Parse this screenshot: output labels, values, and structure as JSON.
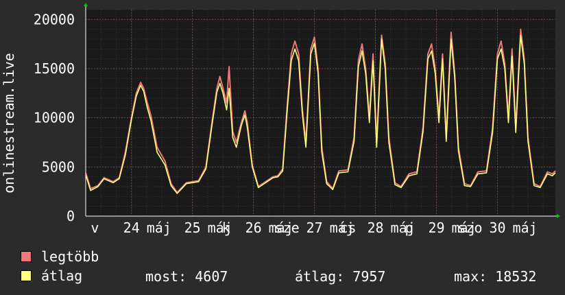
{
  "colors": {
    "background": "#2b2b2b",
    "plot": "#1a1a1a",
    "grid_major": "#6a4848",
    "grid_minor": "#3a3434",
    "axis": "#ffffff",
    "text": "#ffffff",
    "series_max": "#f07878",
    "series_avg": "#ffff80",
    "arrow": "#00cc00"
  },
  "chart_data": {
    "type": "line",
    "ylabel": "onlinestream.live",
    "ylim": [
      0,
      21000
    ],
    "yticks": [
      0,
      5000,
      10000,
      15000,
      20000
    ],
    "xlim": [
      23.25,
      30.95
    ],
    "x_tick_labels": [
      {
        "x": 23.4,
        "label": "v"
      },
      {
        "x": 24.0,
        "label": "24"
      },
      {
        "x": 24.45,
        "label": "máj"
      },
      {
        "x": 25.0,
        "label": "25"
      },
      {
        "x": 25.45,
        "label": "máj"
      },
      {
        "x": 25.55,
        "label": "k"
      },
      {
        "x": 26.0,
        "label": "26"
      },
      {
        "x": 26.45,
        "label": "máj"
      },
      {
        "x": 26.55,
        "label": "sze"
      },
      {
        "x": 27.0,
        "label": "27"
      },
      {
        "x": 27.45,
        "label": "máj"
      },
      {
        "x": 27.55,
        "label": "cs"
      },
      {
        "x": 28.0,
        "label": "28"
      },
      {
        "x": 28.45,
        "label": "máj"
      },
      {
        "x": 28.55,
        "label": "p"
      },
      {
        "x": 29.0,
        "label": "29"
      },
      {
        "x": 29.45,
        "label": "máj"
      },
      {
        "x": 29.55,
        "label": "szo"
      },
      {
        "x": 30.0,
        "label": "30"
      },
      {
        "x": 30.45,
        "label": "máj"
      }
    ],
    "series": [
      {
        "name": "legtöbb",
        "color": "#f07878",
        "values": [
          [
            23.25,
            4400
          ],
          [
            23.33,
            2800
          ],
          [
            23.45,
            3100
          ],
          [
            23.55,
            3900
          ],
          [
            23.7,
            3500
          ],
          [
            23.8,
            3900
          ],
          [
            23.9,
            6500
          ],
          [
            24.0,
            10000
          ],
          [
            24.08,
            12500
          ],
          [
            24.15,
            13600
          ],
          [
            24.2,
            13000
          ],
          [
            24.26,
            11500
          ],
          [
            24.32,
            10200
          ],
          [
            24.42,
            7000
          ],
          [
            24.55,
            5600
          ],
          [
            24.65,
            3300
          ],
          [
            24.75,
            2400
          ],
          [
            24.9,
            3400
          ],
          [
            25.1,
            3600
          ],
          [
            25.22,
            5000
          ],
          [
            25.32,
            9500
          ],
          [
            25.4,
            13000
          ],
          [
            25.45,
            14200
          ],
          [
            25.5,
            13000
          ],
          [
            25.56,
            11500
          ],
          [
            25.6,
            15200
          ],
          [
            25.66,
            8600
          ],
          [
            25.72,
            7500
          ],
          [
            25.8,
            9500
          ],
          [
            25.86,
            10700
          ],
          [
            25.9,
            9500
          ],
          [
            25.98,
            5200
          ],
          [
            26.08,
            3000
          ],
          [
            26.2,
            3500
          ],
          [
            26.32,
            4000
          ],
          [
            26.4,
            4100
          ],
          [
            26.48,
            4800
          ],
          [
            26.55,
            11000
          ],
          [
            26.62,
            16500
          ],
          [
            26.68,
            17800
          ],
          [
            26.74,
            16500
          ],
          [
            26.8,
            11000
          ],
          [
            26.86,
            7500
          ],
          [
            26.94,
            17000
          ],
          [
            27.0,
            18200
          ],
          [
            27.06,
            15000
          ],
          [
            27.12,
            7000
          ],
          [
            27.2,
            3500
          ],
          [
            27.3,
            2800
          ],
          [
            27.4,
            4600
          ],
          [
            27.55,
            4700
          ],
          [
            27.65,
            8000
          ],
          [
            27.72,
            15800
          ],
          [
            27.78,
            17500
          ],
          [
            27.84,
            15000
          ],
          [
            27.9,
            10000
          ],
          [
            27.96,
            16500
          ],
          [
            28.02,
            7500
          ],
          [
            28.1,
            18400
          ],
          [
            28.16,
            15500
          ],
          [
            28.22,
            8000
          ],
          [
            28.32,
            3400
          ],
          [
            28.42,
            3000
          ],
          [
            28.55,
            4300
          ],
          [
            28.68,
            4500
          ],
          [
            28.78,
            9000
          ],
          [
            28.86,
            16500
          ],
          [
            28.92,
            17500
          ],
          [
            28.98,
            15000
          ],
          [
            29.04,
            10000
          ],
          [
            29.1,
            16500
          ],
          [
            29.16,
            8000
          ],
          [
            29.24,
            18700
          ],
          [
            29.3,
            14500
          ],
          [
            29.36,
            7000
          ],
          [
            29.46,
            3300
          ],
          [
            29.56,
            3100
          ],
          [
            29.68,
            4500
          ],
          [
            29.82,
            4600
          ],
          [
            29.92,
            9000
          ],
          [
            30.0,
            16500
          ],
          [
            30.06,
            17800
          ],
          [
            30.12,
            15500
          ],
          [
            30.18,
            10000
          ],
          [
            30.24,
            17000
          ],
          [
            30.3,
            9000
          ],
          [
            30.38,
            19000
          ],
          [
            30.44,
            16000
          ],
          [
            30.5,
            8000
          ],
          [
            30.6,
            3300
          ],
          [
            30.7,
            3000
          ],
          [
            30.82,
            4500
          ],
          [
            30.9,
            4300
          ],
          [
            30.95,
            4600
          ]
        ]
      },
      {
        "name": "átlag",
        "color": "#ffff80",
        "values": [
          [
            23.25,
            4200
          ],
          [
            23.33,
            2600
          ],
          [
            23.45,
            3000
          ],
          [
            23.55,
            3800
          ],
          [
            23.7,
            3400
          ],
          [
            23.8,
            3800
          ],
          [
            23.9,
            6200
          ],
          [
            24.0,
            9800
          ],
          [
            24.08,
            12200
          ],
          [
            24.15,
            13300
          ],
          [
            24.2,
            12700
          ],
          [
            24.26,
            11000
          ],
          [
            24.32,
            9700
          ],
          [
            24.42,
            6500
          ],
          [
            24.55,
            5200
          ],
          [
            24.65,
            3100
          ],
          [
            24.75,
            2300
          ],
          [
            24.9,
            3300
          ],
          [
            25.1,
            3500
          ],
          [
            25.22,
            4800
          ],
          [
            25.32,
            9200
          ],
          [
            25.4,
            12600
          ],
          [
            25.45,
            13500
          ],
          [
            25.5,
            12500
          ],
          [
            25.56,
            10800
          ],
          [
            25.6,
            13000
          ],
          [
            25.66,
            8000
          ],
          [
            25.72,
            7000
          ],
          [
            25.8,
            9200
          ],
          [
            25.86,
            10300
          ],
          [
            25.9,
            9000
          ],
          [
            25.98,
            5000
          ],
          [
            26.08,
            2900
          ],
          [
            26.2,
            3400
          ],
          [
            26.32,
            3900
          ],
          [
            26.4,
            4000
          ],
          [
            26.48,
            4600
          ],
          [
            26.55,
            10500
          ],
          [
            26.62,
            15800
          ],
          [
            26.68,
            17000
          ],
          [
            26.74,
            15800
          ],
          [
            26.8,
            10500
          ],
          [
            26.86,
            7000
          ],
          [
            26.94,
            16500
          ],
          [
            27.0,
            17600
          ],
          [
            27.06,
            14500
          ],
          [
            27.12,
            6500
          ],
          [
            27.2,
            3300
          ],
          [
            27.3,
            2700
          ],
          [
            27.4,
            4400
          ],
          [
            27.55,
            4500
          ],
          [
            27.65,
            7600
          ],
          [
            27.72,
            15200
          ],
          [
            27.78,
            16800
          ],
          [
            27.84,
            14500
          ],
          [
            27.9,
            9500
          ],
          [
            27.96,
            15800
          ],
          [
            28.02,
            7000
          ],
          [
            28.1,
            18000
          ],
          [
            28.16,
            15000
          ],
          [
            28.22,
            7500
          ],
          [
            28.32,
            3200
          ],
          [
            28.42,
            2900
          ],
          [
            28.55,
            4100
          ],
          [
            28.68,
            4300
          ],
          [
            28.78,
            8600
          ],
          [
            28.86,
            16000
          ],
          [
            28.92,
            16800
          ],
          [
            28.98,
            14500
          ],
          [
            29.04,
            9500
          ],
          [
            29.1,
            16000
          ],
          [
            29.16,
            7600
          ],
          [
            29.24,
            18000
          ],
          [
            29.3,
            14000
          ],
          [
            29.36,
            6600
          ],
          [
            29.46,
            3100
          ],
          [
            29.56,
            3000
          ],
          [
            29.68,
            4300
          ],
          [
            29.82,
            4400
          ],
          [
            29.92,
            8500
          ],
          [
            30.0,
            16000
          ],
          [
            30.06,
            17000
          ],
          [
            30.12,
            15000
          ],
          [
            30.18,
            9500
          ],
          [
            30.24,
            16300
          ],
          [
            30.3,
            8500
          ],
          [
            30.38,
            18400
          ],
          [
            30.44,
            15500
          ],
          [
            30.5,
            7600
          ],
          [
            30.6,
            3100
          ],
          [
            30.7,
            2900
          ],
          [
            30.82,
            4300
          ],
          [
            30.9,
            4100
          ],
          [
            30.95,
            4400
          ]
        ]
      }
    ]
  },
  "legend": {
    "items": [
      {
        "label": "legtöbb",
        "color": "#f07878"
      },
      {
        "label": "átlag",
        "color": "#ffff80"
      }
    ],
    "stats": [
      {
        "label": "most:",
        "value": "4607"
      },
      {
        "label": "átlag:",
        "value": "7957"
      },
      {
        "label": "max:",
        "value": "18532"
      }
    ]
  }
}
